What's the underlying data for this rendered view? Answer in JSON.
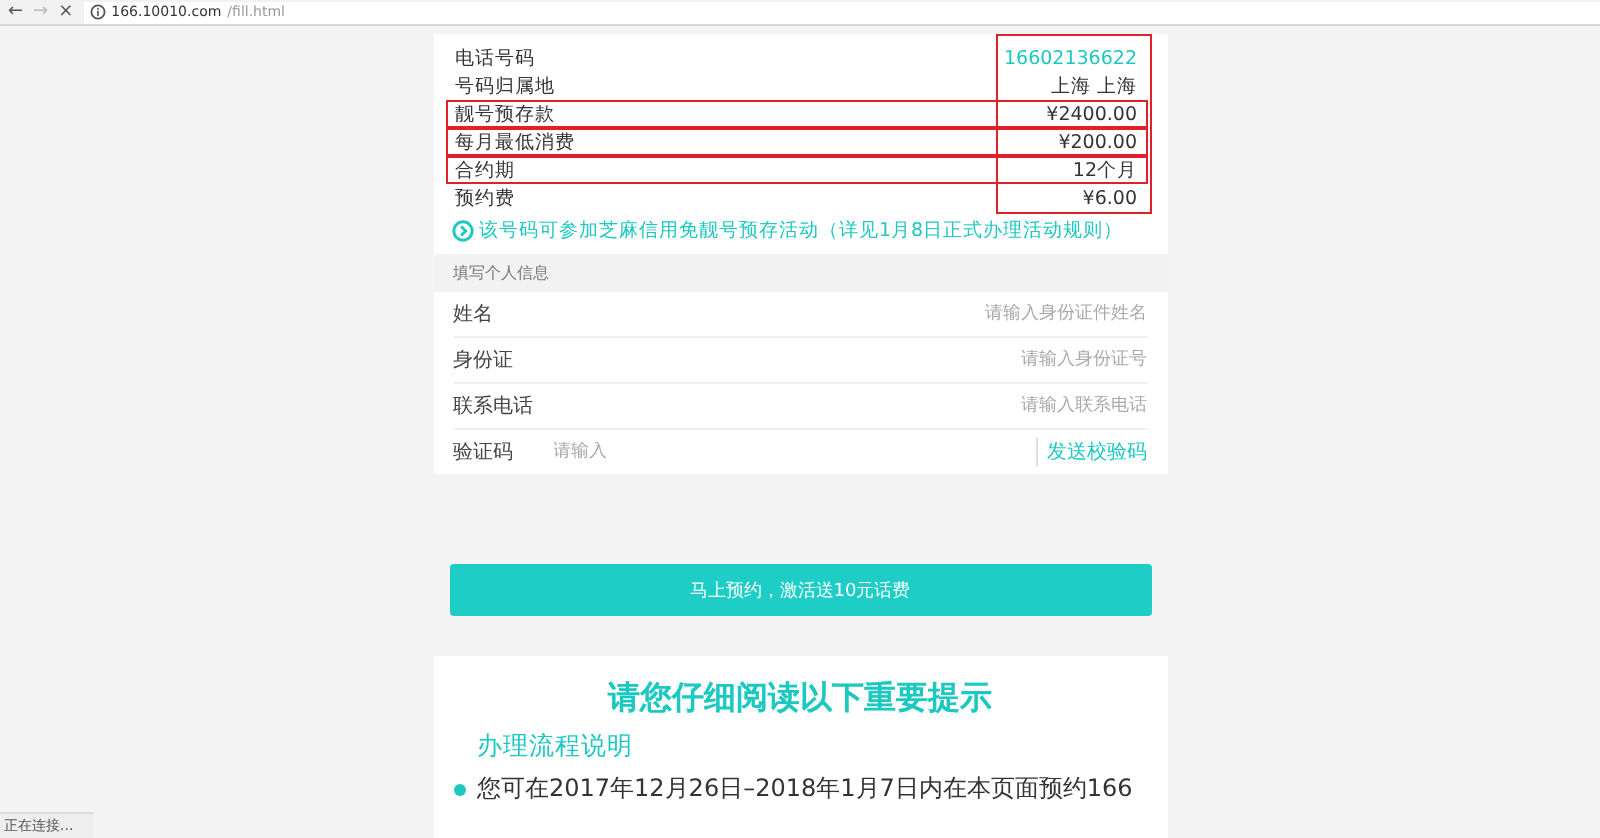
{
  "browser": {
    "back": "←",
    "forward": "→",
    "stop": "×",
    "address_host": "166.10010.com",
    "address_path": "/fill.html"
  },
  "number_info": {
    "value_column_outlined": true,
    "rows": [
      {
        "label": "电话号码",
        "value": "16602136622",
        "kind": "link",
        "outlined": false
      },
      {
        "label": "号码归属地",
        "value": "上海 上海",
        "kind": "plain",
        "outlined": false
      },
      {
        "label": "靓号预存款",
        "value": "¥2400.00",
        "kind": "plain",
        "outlined": true
      },
      {
        "label": "每月最低消费",
        "value": "¥200.00",
        "kind": "plain",
        "outlined": true
      },
      {
        "label": "合约期",
        "value": "12个月",
        "kind": "plain",
        "outlined": true
      },
      {
        "label": "预约费",
        "value": "¥6.00",
        "kind": "plain",
        "outlined": false
      }
    ],
    "note": "该号码可参加芝麻信用免靓号预存活动（详见1月8日正式办理活动规则）"
  },
  "personal_info": {
    "header": "填写个人信息",
    "fields": [
      {
        "label": "姓名",
        "placeholder": "请输入身份证件姓名",
        "kind": "right"
      },
      {
        "label": "身份证",
        "placeholder": "请输入身份证号",
        "kind": "right"
      },
      {
        "label": "联系电话",
        "placeholder": "请输入联系电话",
        "kind": "right"
      },
      {
        "label": "验证码",
        "placeholder": "请输入",
        "kind": "code",
        "action": "发送校验码"
      }
    ]
  },
  "submit_button": "马上预约，激活送10元话费",
  "notice": {
    "title": "请您仔细阅读以下重要提示",
    "subtitle": "办理流程说明",
    "items": [
      "您可在2017年12月26日–2018年1月7日内在本页面预约166"
    ]
  },
  "status_bar": "正在连接..."
}
